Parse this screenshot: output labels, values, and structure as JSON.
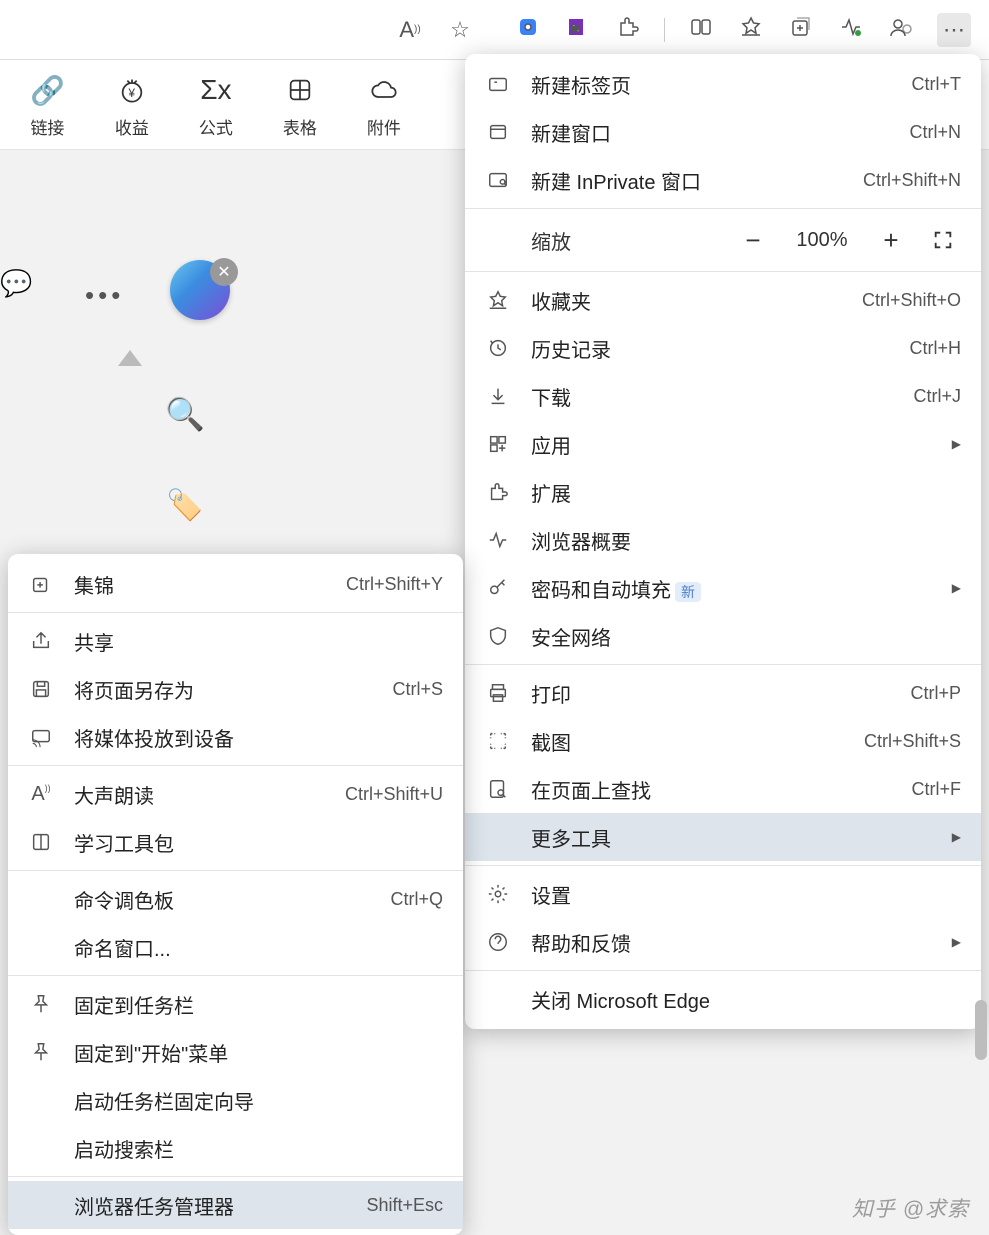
{
  "toolbar": {
    "icons": [
      "read-aloud",
      "favorite-star",
      "copilot",
      "onenote",
      "extensions",
      "split",
      "favorites-menu",
      "collections",
      "performance",
      "profile",
      "more"
    ]
  },
  "appbar": {
    "items": [
      {
        "icon": "🔗",
        "label": "链接"
      },
      {
        "icon": "¥",
        "label": "收益"
      },
      {
        "icon": "Σx",
        "label": "公式"
      },
      {
        "icon": "▦",
        "label": "表格"
      },
      {
        "icon": "☁",
        "label": "附件"
      }
    ]
  },
  "mainmenu": {
    "new_tab": "新建标签页",
    "new_tab_sc": "Ctrl+T",
    "new_window": "新建窗口",
    "new_window_sc": "Ctrl+N",
    "new_inprivate": "新建 InPrivate 窗口",
    "new_inprivate_sc": "Ctrl+Shift+N",
    "zoom_label": "缩放",
    "zoom_value": "100%",
    "favorites": "收藏夹",
    "favorites_sc": "Ctrl+Shift+O",
    "history": "历史记录",
    "history_sc": "Ctrl+H",
    "downloads": "下载",
    "downloads_sc": "Ctrl+J",
    "apps": "应用",
    "extensions": "扩展",
    "browser_essentials": "浏览器概要",
    "passwords": "密码和自动填充",
    "passwords_badge": "新",
    "secure_network": "安全网络",
    "print": "打印",
    "print_sc": "Ctrl+P",
    "screenshot": "截图",
    "screenshot_sc": "Ctrl+Shift+S",
    "find": "在页面上查找",
    "find_sc": "Ctrl+F",
    "more_tools": "更多工具",
    "settings": "设置",
    "help": "帮助和反馈",
    "close_edge": "关闭 Microsoft Edge"
  },
  "submenu": {
    "collections": "集锦",
    "collections_sc": "Ctrl+Shift+Y",
    "share": "共享",
    "save_as": "将页面另存为",
    "save_as_sc": "Ctrl+S",
    "cast": "将媒体投放到设备",
    "read_aloud": "大声朗读",
    "read_aloud_sc": "Ctrl+Shift+U",
    "learning_tools": "学习工具包",
    "command_palette": "命令调色板",
    "command_palette_sc": "Ctrl+Q",
    "name_window": "命名窗口...",
    "pin_taskbar": "固定到任务栏",
    "pin_start": "固定到\"开始\"菜单",
    "launch_taskbar_wizard": "启动任务栏固定向导",
    "launch_searchbar": "启动搜索栏",
    "task_manager": "浏览器任务管理器",
    "task_manager_sc": "Shift+Esc"
  },
  "watermark": "知乎 @求索"
}
